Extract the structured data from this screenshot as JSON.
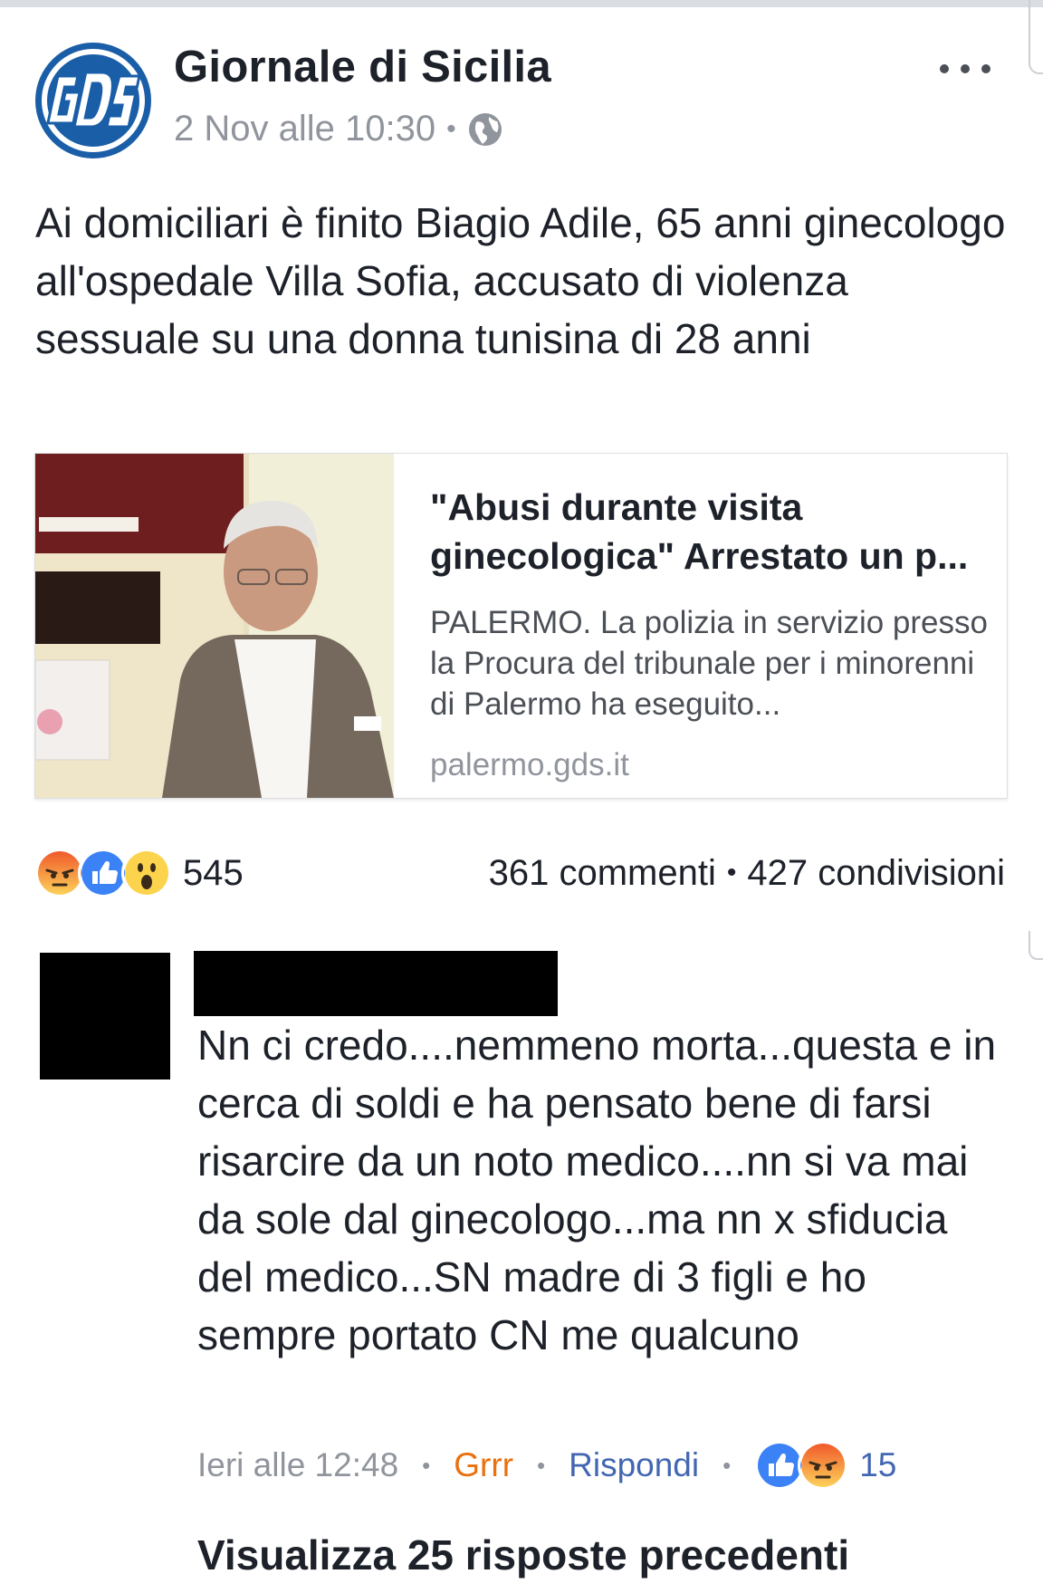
{
  "post": {
    "page_name": "Giornale di Sicilia",
    "timestamp": "2 Nov alle 10:30",
    "separator": "•",
    "privacy_icon": "globe-icon",
    "text": "Ai domiciliari è finito Biagio Adile, 65 anni ginecologo all'ospedale Villa Sofia, accusato di violenza sessuale su una donna tunisina di 28 anni"
  },
  "link_card": {
    "title": "\"Abusi durante visita ginecologica\" Arrestato un p...",
    "description": "PALERMO. La polizia in servizio presso la Procura del tribunale per i minorenni di Palermo ha eseguito...",
    "domain": "palermo.gds.it"
  },
  "stats": {
    "reaction_icons": [
      "angry-icon",
      "like-icon",
      "wow-icon"
    ],
    "reactions_count": "545",
    "comments": "361 commenti",
    "separator": "•",
    "shares": "427 condivisioni"
  },
  "comment": {
    "text": "Nn ci credo....nemmeno morta...questa e in cerca di soldi e ha pensato bene di farsi risarcire da un noto medico....nn si va mai da sole dal ginecologo...ma nn x sfiducia del medico...SN madre di 3 figli e ho sempre portato CN me qualcuno",
    "time": "Ieri alle 12:48",
    "separator": "•",
    "reaction_label": "Grrr",
    "reply_label": "Rispondi",
    "reaction_icons": [
      "like-icon",
      "angry-icon"
    ],
    "reactions_count": "15"
  },
  "view_more_replies": "Visualizza 25 risposte precedenti",
  "colors": {
    "facebook_blue": "#4267b2",
    "angry_orange": "#e9710f",
    "meta_grey": "#90949c",
    "gds_blue": "#1a5ea8"
  }
}
